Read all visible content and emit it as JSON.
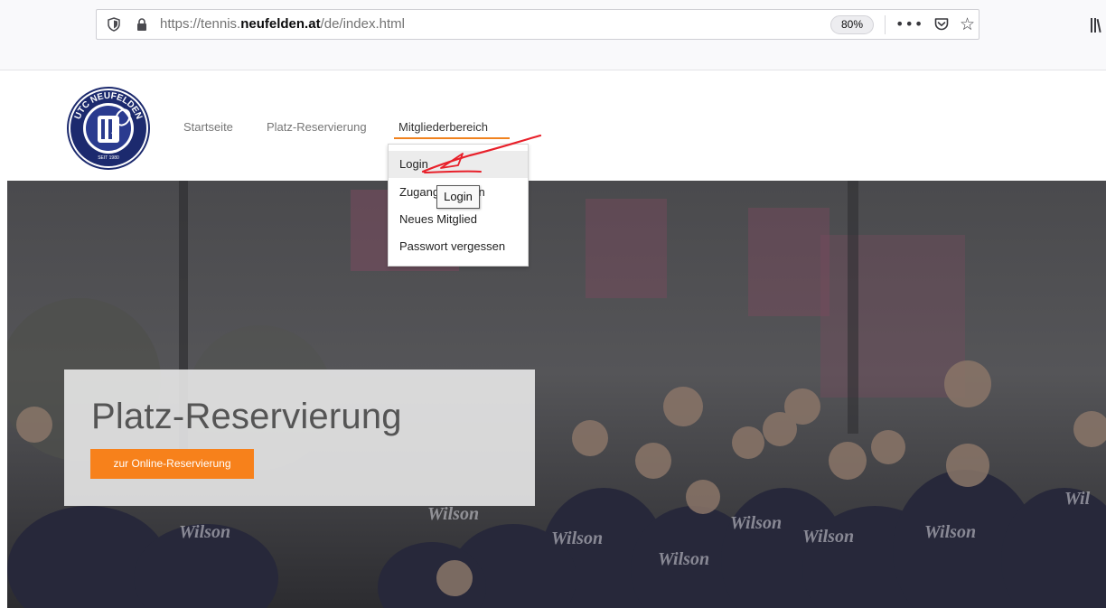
{
  "browser": {
    "url_prefix": "https://tennis.",
    "url_domain": "neufelden.at",
    "url_path": "/de/index.html",
    "zoom": "80%",
    "menu_icon": "•••",
    "icons": [
      "shield-icon",
      "lock-icon",
      "page-actions-icon",
      "pocket-icon",
      "bookmark-star-icon",
      "library-icon"
    ]
  },
  "site": {
    "logo_text": "UTC NEUFELDEN",
    "nav": {
      "start": "Startseite",
      "platz": "Platz-Reservierung",
      "mitglieder": "Mitgliederbereich"
    },
    "accent_color": "#f0821e",
    "dropdown": {
      "login": "Login",
      "zugang": "Zugang erhalten",
      "neues": "Neues Mitglied",
      "passwort": "Passwort vergessen"
    },
    "tooltip": "Login"
  },
  "hero": {
    "title": "Platz-Reservierung",
    "button": "zur Online-Reservierung",
    "button_color": "#f7811b"
  }
}
